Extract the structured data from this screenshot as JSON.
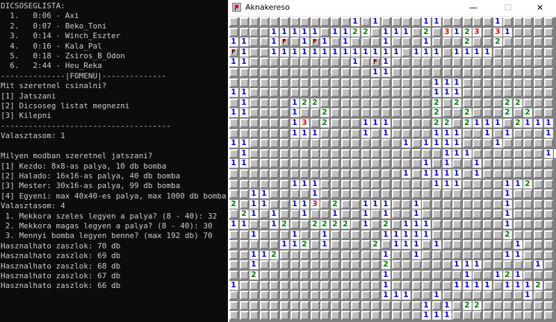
{
  "console": {
    "lines": [
      "DICSOSEGLISTA:",
      "  1.   0:06 - Axi",
      "  2.   0:07 - Beko_Toni",
      "  3.   0:14 - Winch_Eszter",
      "  4.   0:16 - Kala_Pal",
      "  5.   0:18 - Zsiros_B_Odon",
      "  6.   2:44 - Heu_Reka",
      "--------------|FOMENU|--------------",
      "Mit szeretnel csinalni?",
      "[1] Jatszani",
      "[2] Dicsoseg listat megnezni",
      "[3] Kilepni",
      "-------------------------------------",
      "Valasztasom: 1",
      "",
      "Milyen modban szeretnel jatszani?",
      "[1] Kezdo: 8x8-as palya, 10 db bomba",
      "[2] Halado: 16x16-as palya, 40 db bomba",
      "[3] Mester: 30x16-as palya, 99 db bomba",
      "[4] Egyeni: max 40x40-es palya, max 1000 db bomba",
      "Valasztasom: 4",
      " 1. Mekkora szeles legyen a palya? (8 - 40): 32",
      " 2. Mekkora magas legyen a palya? (8 - 40): 30",
      " 3. Mennyi bomba legyen benne? (max 192 db) 70",
      "Hasznalhato zaszlok: 70 db",
      "Hasznalhato zaszlok: 69 db",
      "Hasznalhato zaszlok: 68 db",
      "Hasznalhato zaszlok: 67 db",
      "Hasznalhato zaszlok: 66 db"
    ]
  },
  "window": {
    "title": "Aknakereso",
    "minimize_glyph": "—",
    "maximize_glyph": "☐",
    "close_glyph": "✕"
  },
  "board": {
    "legend": ". = covered, 0 = revealed empty, 1-8 = count, F = flag",
    "colors": {
      "n1": "#0000ff",
      "n2": "#008000",
      "n3": "#ff0000",
      "covered": "#c0c0c0",
      "revealed": "#ffffff"
    },
    "rows": [
      "............1.1....11.....1.....",
      "....11111.1122.111.2.3123.31....",
      "11..1F.1F1.1...1...1...2..2.....",
      "F1..1111111111111.111.1111......",
      "11..........1.F1................",
      "..............11................",
      "....................111.........",
      "11..................111.........",
      ".1....122...........2.2....22...",
      "11....1..2..........2..2...2.2..",
      "......13.2...111....22.2111.2111",
      "......111....1.1....111..1.1...1",
      "11...............1.1111...1.....",
      ".1...................111.......11",
      "11.................1.1..1.......",
      ".................1.1111.1.......",
      "......111...........111....112..",
      "..11....1..................1....",
      "2.11..113.2..111..1........1....",
      ".21.1..1..1..1.1..1........1....",
      "11..12..2222.1.2.111.......1....",
      "..1...1..1.....11111.......2....",
      ".....112.1....2.111.1.......1...",
      "..112..........1..1........11...",
      "..1............2......111.....1.",
      "..2............1.......1..121...",
      "1..............1......1111.1112.",
      "...............111..1........1..",
      "...................1.1.22.......",
      "...................111.........."
    ]
  }
}
